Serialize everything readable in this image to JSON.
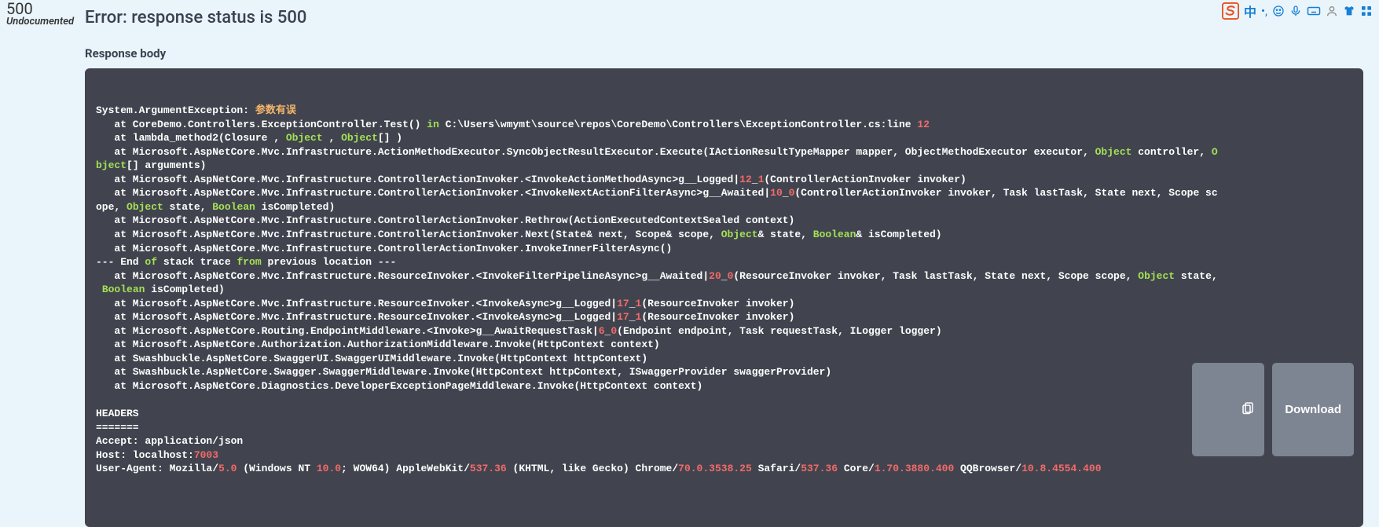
{
  "status": {
    "code": "500",
    "label": "Undocumented",
    "error_heading": "Error: response status is 500",
    "section_title": "Response body"
  },
  "download_label": "Download",
  "response_body": {
    "tokens": [
      {
        "t": "System.ArgumentException:",
        "c": null
      },
      {
        "t": " 参数有误\n",
        "c": "hl-string2"
      },
      {
        "t": "   at CoreDemo.Controllers.ExceptionController.Test() ",
        "c": null
      },
      {
        "t": "in",
        "c": "hl-keyword"
      },
      {
        "t": " C:\\Users\\wmymt\\source\\repos\\CoreDemo\\Controllers\\ExceptionController.cs:line ",
        "c": null
      },
      {
        "t": "12",
        "c": "hl-number"
      },
      {
        "t": "\n",
        "c": null
      },
      {
        "t": "   at lambda_method2(Closure , ",
        "c": null
      },
      {
        "t": "Object",
        "c": "hl-keyword"
      },
      {
        "t": " , ",
        "c": null
      },
      {
        "t": "Object",
        "c": "hl-keyword"
      },
      {
        "t": "[] )\n",
        "c": null
      },
      {
        "t": "   at Microsoft.AspNetCore.Mvc.Infrastructure.ActionMethodExecutor.SyncObjectResultExecutor.Execute(IActionResultTypeMapper mapper, ObjectMethodExecutor executor, ",
        "c": null
      },
      {
        "t": "Object",
        "c": "hl-keyword"
      },
      {
        "t": " controller, ",
        "c": null
      },
      {
        "t": "O",
        "c": "hl-keyword"
      },
      {
        "t": "\n",
        "c": null
      },
      {
        "t": "bject",
        "c": "hl-keyword"
      },
      {
        "t": "[] arguments)\n",
        "c": null
      },
      {
        "t": "   at Microsoft.AspNetCore.Mvc.Infrastructure.ControllerActionInvoker.<InvokeActionMethodAsync>g__Logged|",
        "c": null
      },
      {
        "t": "12",
        "c": "hl-number"
      },
      {
        "t": "_",
        "c": null
      },
      {
        "t": "1",
        "c": "hl-number"
      },
      {
        "t": "(ControllerActionInvoker invoker)\n",
        "c": null
      },
      {
        "t": "   at Microsoft.AspNetCore.Mvc.Infrastructure.ControllerActionInvoker.<InvokeNextActionFilterAsync>g__Awaited|",
        "c": null
      },
      {
        "t": "10",
        "c": "hl-number"
      },
      {
        "t": "_",
        "c": null
      },
      {
        "t": "0",
        "c": "hl-number"
      },
      {
        "t": "(ControllerActionInvoker invoker, Task lastTask, State next, Scope sc\nope, ",
        "c": null
      },
      {
        "t": "Object",
        "c": "hl-keyword"
      },
      {
        "t": " state, ",
        "c": null
      },
      {
        "t": "Boolean",
        "c": "hl-keyword"
      },
      {
        "t": " isCompleted)\n",
        "c": null
      },
      {
        "t": "   at Microsoft.AspNetCore.Mvc.Infrastructure.ControllerActionInvoker.Rethrow(ActionExecutedContextSealed context)\n",
        "c": null
      },
      {
        "t": "   at Microsoft.AspNetCore.Mvc.Infrastructure.ControllerActionInvoker.Next(State& next, Scope& scope, ",
        "c": null
      },
      {
        "t": "Object",
        "c": "hl-keyword"
      },
      {
        "t": "& state, ",
        "c": null
      },
      {
        "t": "Boolean",
        "c": "hl-keyword"
      },
      {
        "t": "& isCompleted)\n",
        "c": null
      },
      {
        "t": "   at Microsoft.AspNetCore.Mvc.Infrastructure.ControllerActionInvoker.InvokeInnerFilterAsync()\n",
        "c": null
      },
      {
        "t": "--- End ",
        "c": null
      },
      {
        "t": "of",
        "c": "hl-keyword"
      },
      {
        "t": " stack trace ",
        "c": null
      },
      {
        "t": "from",
        "c": "hl-keyword"
      },
      {
        "t": " previous location ---\n",
        "c": null
      },
      {
        "t": "   at Microsoft.AspNetCore.Mvc.Infrastructure.ResourceInvoker.<InvokeFilterPipelineAsync>g__Awaited|",
        "c": null
      },
      {
        "t": "20",
        "c": "hl-number"
      },
      {
        "t": "_",
        "c": null
      },
      {
        "t": "0",
        "c": "hl-number"
      },
      {
        "t": "(ResourceInvoker invoker, Task lastTask, State next, Scope scope, ",
        "c": null
      },
      {
        "t": "Object",
        "c": "hl-keyword"
      },
      {
        "t": " state,\n ",
        "c": null
      },
      {
        "t": "Boolean",
        "c": "hl-keyword"
      },
      {
        "t": " isCompleted)\n",
        "c": null
      },
      {
        "t": "   at Microsoft.AspNetCore.Mvc.Infrastructure.ResourceInvoker.<InvokeAsync>g__Logged|",
        "c": null
      },
      {
        "t": "17",
        "c": "hl-number"
      },
      {
        "t": "_",
        "c": null
      },
      {
        "t": "1",
        "c": "hl-number"
      },
      {
        "t": "(ResourceInvoker invoker)\n",
        "c": null
      },
      {
        "t": "   at Microsoft.AspNetCore.Mvc.Infrastructure.ResourceInvoker.<InvokeAsync>g__Logged|",
        "c": null
      },
      {
        "t": "17",
        "c": "hl-number"
      },
      {
        "t": "_",
        "c": null
      },
      {
        "t": "1",
        "c": "hl-number"
      },
      {
        "t": "(ResourceInvoker invoker)\n",
        "c": null
      },
      {
        "t": "   at Microsoft.AspNetCore.Routing.EndpointMiddleware.<Invoke>g__AwaitRequestTask|",
        "c": null
      },
      {
        "t": "6",
        "c": "hl-number"
      },
      {
        "t": "_",
        "c": null
      },
      {
        "t": "0",
        "c": "hl-number"
      },
      {
        "t": "(Endpoint endpoint, Task requestTask, ILogger logger)\n",
        "c": null
      },
      {
        "t": "   at Microsoft.AspNetCore.Authorization.AuthorizationMiddleware.Invoke(HttpContext context)\n",
        "c": null
      },
      {
        "t": "   at Swashbuckle.AspNetCore.SwaggerUI.SwaggerUIMiddleware.Invoke(HttpContext httpContext)\n",
        "c": null
      },
      {
        "t": "   at Swashbuckle.AspNetCore.Swagger.SwaggerMiddleware.Invoke(HttpContext httpContext, ISwaggerProvider swaggerProvider)\n",
        "c": null
      },
      {
        "t": "   at Microsoft.AspNetCore.Diagnostics.DeveloperExceptionPageMiddleware.Invoke(HttpContext context)\n\n",
        "c": null
      },
      {
        "t": "HEADERS\n=======\n",
        "c": null
      },
      {
        "t": "Accept: application/json\n",
        "c": null
      },
      {
        "t": "Host: localhost:",
        "c": null
      },
      {
        "t": "7003",
        "c": "hl-number"
      },
      {
        "t": "\n",
        "c": null
      },
      {
        "t": "User-Agent: Mozilla/",
        "c": null
      },
      {
        "t": "5.0",
        "c": "hl-number"
      },
      {
        "t": " (Windows NT ",
        "c": null
      },
      {
        "t": "10.0",
        "c": "hl-number"
      },
      {
        "t": "; WOW64) AppleWebKit/",
        "c": null
      },
      {
        "t": "537.36",
        "c": "hl-number"
      },
      {
        "t": " (KHTML, like Gecko) Chrome/",
        "c": null
      },
      {
        "t": "70.0.3538.25",
        "c": "hl-number"
      },
      {
        "t": " Safari/",
        "c": null
      },
      {
        "t": "537.36",
        "c": "hl-number"
      },
      {
        "t": " Core/",
        "c": null
      },
      {
        "t": "1.70.3880.400",
        "c": "hl-number"
      },
      {
        "t": " QQBrowser/",
        "c": null
      },
      {
        "t": "10.8.4554.400",
        "c": "hl-number"
      }
    ]
  },
  "ime": {
    "zhong": "中"
  }
}
